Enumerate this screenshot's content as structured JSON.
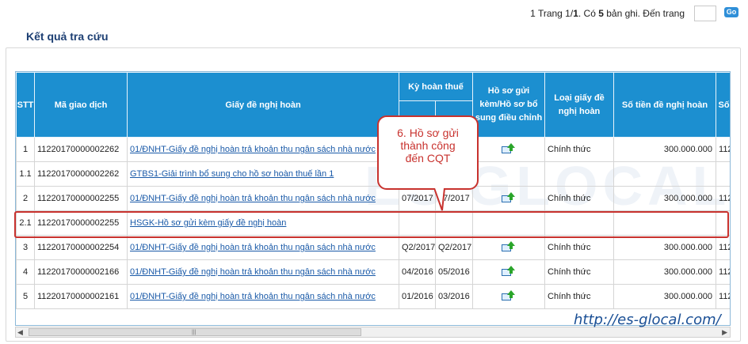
{
  "pager": {
    "text_pre": "1  Trang 1/",
    "total_pages": "1",
    "text_mid": ". Có ",
    "records": "5",
    "text_post": " bản ghi. Đến trang",
    "go_label": "Go"
  },
  "title": "Kết quả tra cứu",
  "columns": {
    "stt": "STT",
    "ma_giao_dich": "Mã giao dịch",
    "giay_de_nghi": "Giấy đề nghị hoàn",
    "ky_hoan_thue": "Kỳ hoàn thuế",
    "ho_so_gui": "Hồ sơ gửi kèm/Hồ sơ bổ sung điều chỉnh",
    "loai_giay": "Loại giấy đề nghị hoàn",
    "so_tien": "Số tiền đề nghị hoàn",
    "so_next": "Số"
  },
  "rows": [
    {
      "stt": "1",
      "ma": "11220170000002262",
      "giay": "01/ĐNHT-Giấy đề nghị hoàn trả khoản thu ngân sách nhà nước",
      "tu": "",
      "den": "",
      "icon": true,
      "loai": "Chính thức",
      "tien": "300.000.000",
      "next": "112"
    },
    {
      "stt": "1.1",
      "ma": "11220170000002262",
      "giay": "GTBS1-Giải trình bổ sung cho hồ sơ hoàn thuế lần 1",
      "tu": "",
      "den": "",
      "icon": false,
      "loai": "",
      "tien": "",
      "next": ""
    },
    {
      "stt": "2",
      "ma": "11220170000002255",
      "giay": "01/ĐNHT-Giấy đề nghị hoàn trả khoản thu ngân sách nhà nước",
      "tu": "07/2017",
      "den": "07/2017",
      "icon": true,
      "loai": "Chính thức",
      "tien": "300.000.000",
      "next": "112"
    },
    {
      "stt": "2.1",
      "ma": "11220170000002255",
      "giay": "HSGK-Hồ sơ gửi kèm giấy đề nghị hoàn",
      "tu": "",
      "den": "",
      "icon": false,
      "loai": "",
      "tien": "",
      "next": ""
    },
    {
      "stt": "3",
      "ma": "11220170000002254",
      "giay": "01/ĐNHT-Giấy đề nghị hoàn trả khoản thu ngân sách nhà nước",
      "tu": "Q2/2017",
      "den": "Q2/2017",
      "icon": true,
      "loai": "Chính thức",
      "tien": "300.000.000",
      "next": "112"
    },
    {
      "stt": "4",
      "ma": "11220170000002166",
      "giay": "01/ĐNHT-Giấy đề nghị hoàn trả khoản thu ngân sách nhà nước",
      "tu": "04/2016",
      "den": "05/2016",
      "icon": true,
      "loai": "Chính thức",
      "tien": "300.000.000",
      "next": "112"
    },
    {
      "stt": "5",
      "ma": "11220170000002161",
      "giay": "01/ĐNHT-Giấy đề nghị hoàn trả khoản thu ngân sách nhà nước",
      "tu": "01/2016",
      "den": "03/2016",
      "icon": true,
      "loai": "Chính thức",
      "tien": "300.000.000",
      "next": "112"
    }
  ],
  "callout": {
    "line1": "6. Hồ sơ gửi",
    "line2": "thành công",
    "line3": "đến CQT"
  },
  "watermark": "ES GLOCAL",
  "site_url": "http://es-glocal.com/",
  "colors": {
    "header_bg": "#1c8fd0",
    "title": "#1d3f73",
    "callout": "#c8322e",
    "link": "#1a5aa8"
  },
  "icons": {
    "upload": "upload-arrow-icon",
    "scroll_left": "arrow-left-icon",
    "scroll_right": "arrow-right-icon"
  }
}
